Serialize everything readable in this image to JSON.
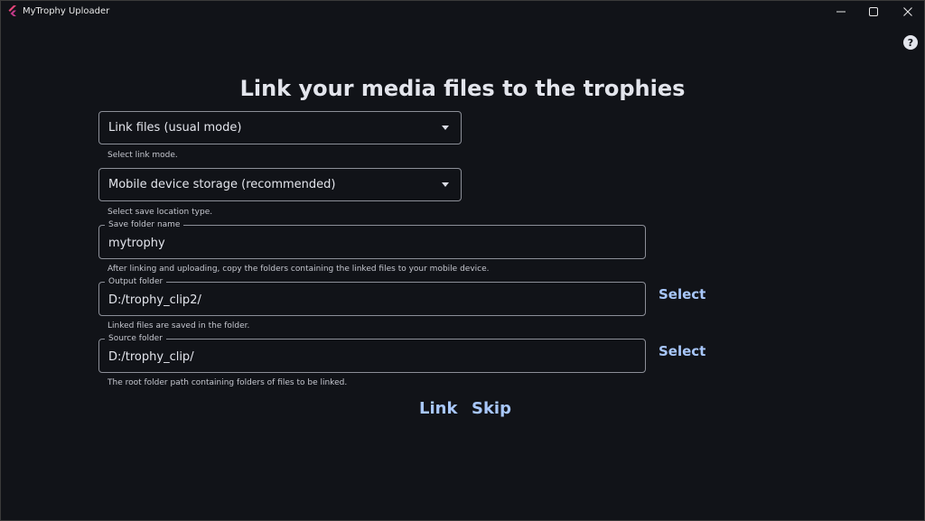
{
  "window": {
    "title": "MyTrophy Uploader"
  },
  "page": {
    "heading": "Link your media files to the trophies"
  },
  "link_mode": {
    "selected": "Link files (usual mode)",
    "helper": "Select link mode."
  },
  "location_type": {
    "selected": "Mobile device storage (recommended)",
    "helper": "Select save location type."
  },
  "save_folder": {
    "label": "Save folder name",
    "value": "mytrophy",
    "helper": "After linking and uploading, copy the folders containing the linked files to your mobile device."
  },
  "output_folder": {
    "label": "Output folder",
    "value": "D:/trophy_clip2/",
    "helper": "Linked files are saved in the folder.",
    "select_label": "Select"
  },
  "source_folder": {
    "label": "Source folder",
    "value": "D:/trophy_clip/",
    "helper": "The root folder path containing folders of files to be linked.",
    "select_label": "Select"
  },
  "actions": {
    "link_label": "Link",
    "skip_label": "Skip"
  },
  "colors": {
    "background": "#111318",
    "accent": "#a8c7fa",
    "text": "#e3e5ec",
    "outline": "#8c8f98"
  },
  "icons": {
    "app": "flutter-logo-icon",
    "minimize": "minimize-icon",
    "maximize": "maximize-icon",
    "close": "close-icon",
    "help": "help-circle-icon",
    "dropdown": "caret-down-icon"
  }
}
